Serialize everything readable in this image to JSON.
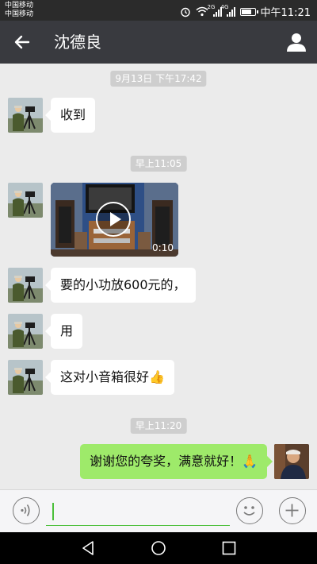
{
  "status_bar": {
    "carrier_1": "中国移动",
    "carrier_2": "中国移动",
    "signal_1_label": "2G",
    "signal_2_label": "4G",
    "battery_level": 0.85,
    "time": "中午11:21",
    "icons": [
      "alarm-icon",
      "wifi-icon",
      "signal-icon",
      "battery-icon"
    ]
  },
  "header": {
    "title": "沈德良",
    "back_icon": "arrow-left-icon",
    "profile_icon": "person-icon"
  },
  "messages": [
    {
      "type": "timestamp",
      "text": "9月13日 下午17:42"
    },
    {
      "type": "text",
      "side": "left",
      "text": "收到"
    },
    {
      "type": "timestamp",
      "text": "早上11:05"
    },
    {
      "type": "video",
      "side": "left",
      "duration": "0:10"
    },
    {
      "type": "text",
      "side": "left",
      "text": "要的小功放600元的，"
    },
    {
      "type": "text",
      "side": "left",
      "text": "用"
    },
    {
      "type": "text",
      "side": "left",
      "text": "这对小音箱很好👍"
    },
    {
      "type": "timestamp",
      "text": "早上11:20"
    },
    {
      "type": "text",
      "side": "right",
      "text": "谢谢您的夸奖，满意就好！🙏"
    }
  ],
  "input_bar": {
    "value": "",
    "voice_icon": "voice-icon",
    "emoji_icon": "emoji-icon",
    "plus_icon": "plus-icon"
  },
  "colors": {
    "header_bg": "#393a3f",
    "chat_bg": "#ebebeb",
    "sent_bubble": "#9eea6a",
    "received_bubble": "#ffffff",
    "accent": "#4bbf3a"
  }
}
